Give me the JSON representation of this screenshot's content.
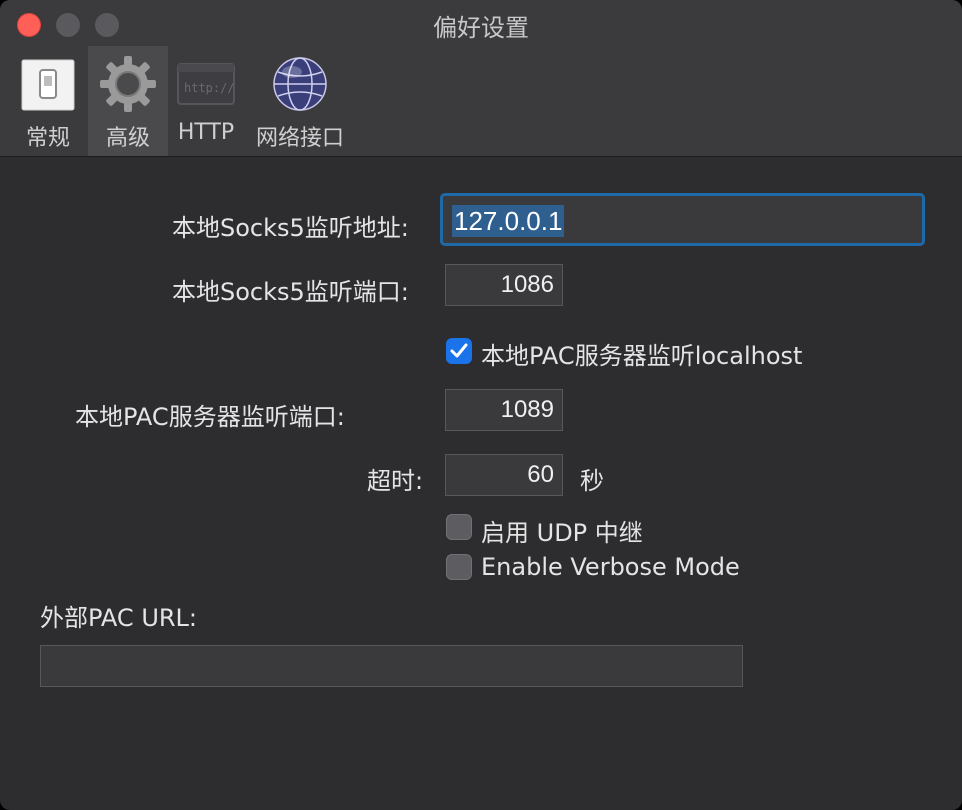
{
  "window": {
    "title": "偏好设置"
  },
  "toolbar": {
    "tabs": [
      {
        "label": "常规",
        "icon": "switch-icon"
      },
      {
        "label": "高级",
        "icon": "gear-icon"
      },
      {
        "label": "HTTP",
        "icon": "http-icon"
      },
      {
        "label": "网络接口",
        "icon": "globe-icon"
      }
    ],
    "selected": "高级"
  },
  "form": {
    "socks5_address_label": "本地Socks5监听地址:",
    "socks5_address_value": "127.0.0.1",
    "socks5_port_label": "本地Socks5监听端口:",
    "socks5_port_value": "1086",
    "pac_localhost_label": "本地PAC服务器监听localhost",
    "pac_localhost_checked": true,
    "pac_port_label": "本地PAC服务器监听端口:",
    "pac_port_value": "1089",
    "timeout_label": "超时:",
    "timeout_value": "60",
    "timeout_unit": "秒",
    "udp_relay_label": "启用 UDP 中继",
    "udp_relay_checked": false,
    "verbose_label": "Enable Verbose Mode",
    "verbose_checked": false,
    "pac_url_label": "外部PAC URL:",
    "pac_url_value": ""
  },
  "colors": {
    "accent": "#1a73e8",
    "focus_ring": "#1e6aa8",
    "close": "#ff5f57"
  }
}
